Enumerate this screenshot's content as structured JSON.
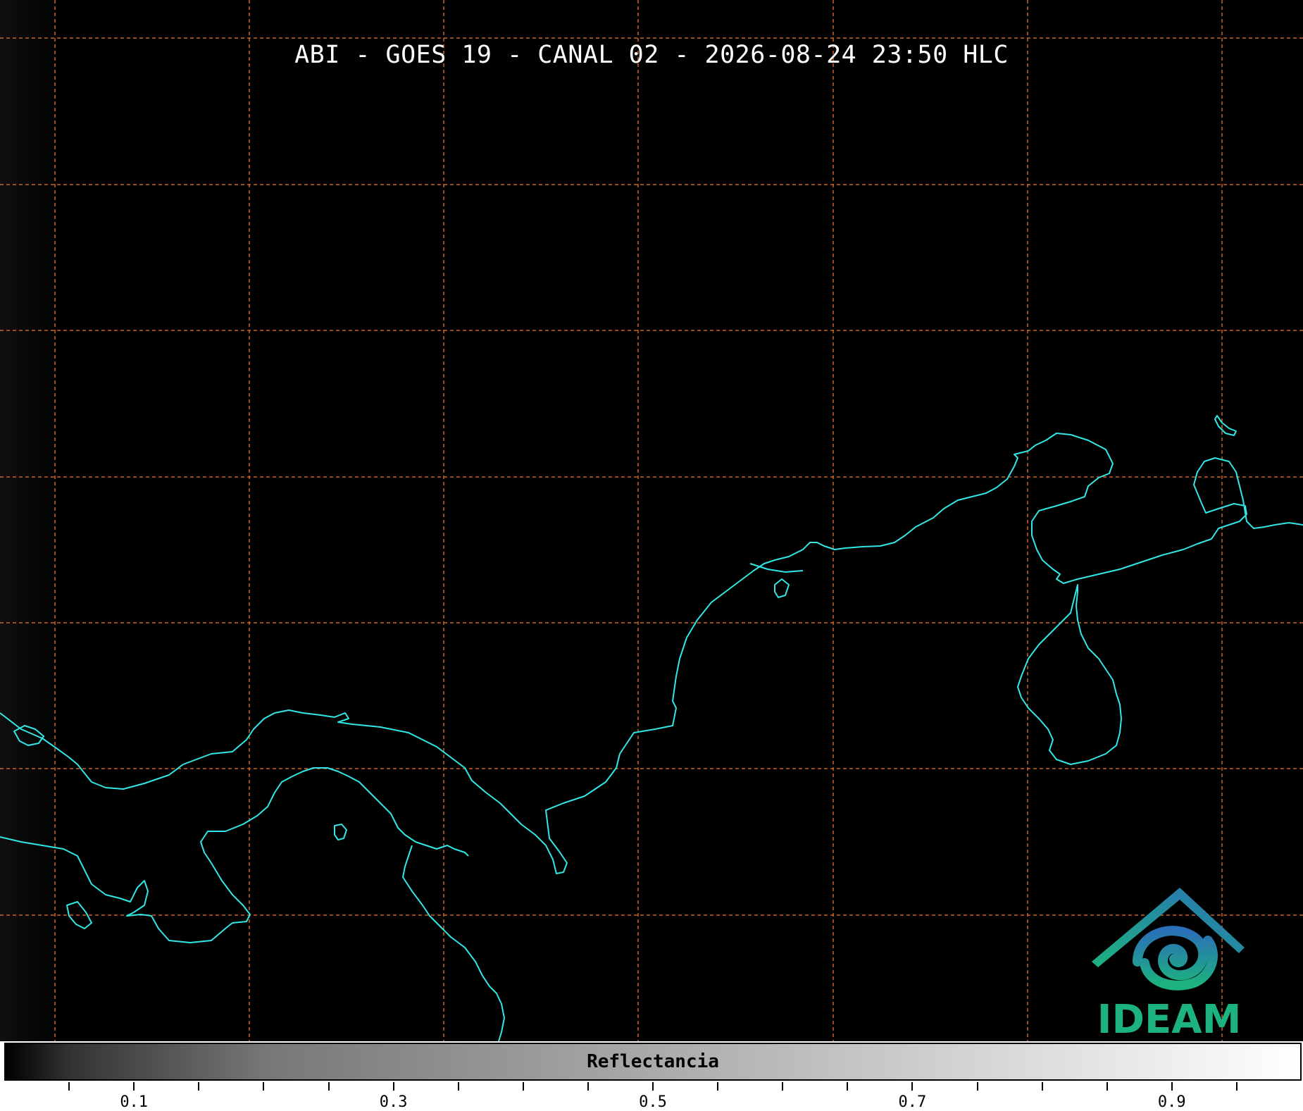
{
  "title": "ABI - GOES 19 - CANAL 02 - 2026-08-24 23:50 HLC",
  "colorbar": {
    "label": "Reflectancia",
    "tick_labels": [
      "0.1",
      "0.3",
      "0.5",
      "0.7",
      "0.9"
    ],
    "range": [
      0.0,
      1.0
    ]
  },
  "logo": {
    "text": "IDEAM"
  },
  "colors": {
    "background": "#000000",
    "coastline": "#33e6e6",
    "grid": "#c8642a",
    "logo_green": "#1db37e",
    "logo_blue": "#2a6fb8"
  },
  "map": {
    "gridlines": "dashed",
    "coastline_icon": "coastline-outline"
  }
}
